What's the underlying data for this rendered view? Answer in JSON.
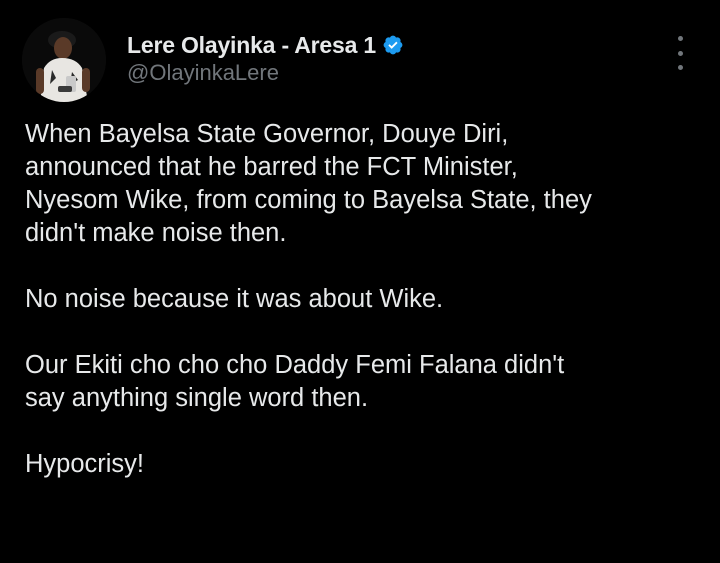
{
  "author": {
    "display_name": "Lere Olayinka - Aresa 1",
    "handle": "@OlayinkaLere",
    "verified": true,
    "avatar_icon": "profile-photo",
    "verified_icon": "verified-badge-icon"
  },
  "menu": {
    "icon": "more-options-icon"
  },
  "tweet": {
    "paragraphs": [
      "When Bayelsa State Governor,  Douye Diri,\nannounced that he barred the FCT Minister,\nNyesom Wike,  from coming to Bayelsa State, they\ndidn't make noise then.",
      "No noise because it was about Wike.",
      "Our Ekiti cho cho cho Daddy Femi Falana didn't\nsay anything single word then.",
      "Hypocrisy!"
    ]
  },
  "colors": {
    "background": "#000000",
    "text_primary": "#e7e9ea",
    "text_secondary": "#71767b",
    "verified_blue": "#1d9bf0"
  }
}
